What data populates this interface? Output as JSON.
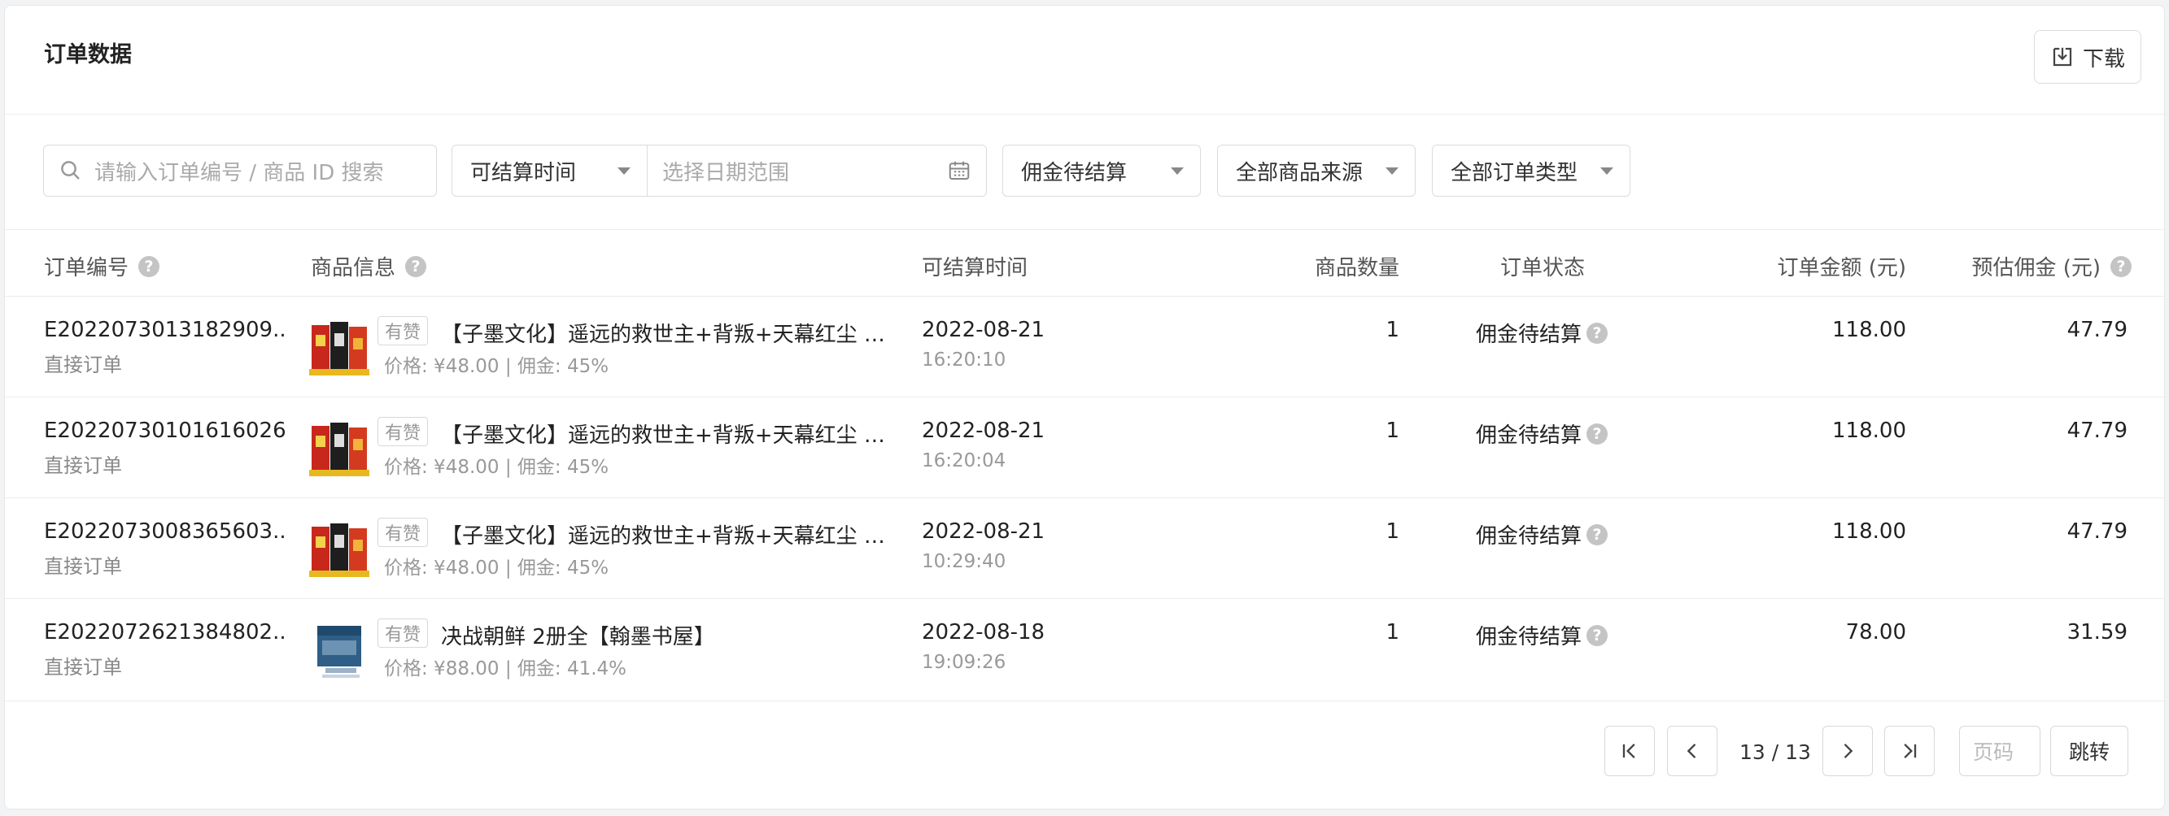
{
  "header": {
    "title": "订单数据",
    "download_label": "下载"
  },
  "filters": {
    "search_placeholder": "请输入订单编号 / 商品 ID 搜索",
    "time_select": "可结算时间",
    "date_placeholder": "选择日期范围",
    "commission_status": "佣金待结算",
    "product_source": "全部商品来源",
    "order_type": "全部订单类型"
  },
  "table": {
    "columns": [
      "订单编号",
      "商品信息",
      "可结算时间",
      "商品数量",
      "订单状态",
      "订单金额 (元)",
      "预估佣金 (元)"
    ],
    "rows": [
      {
        "order_id": "E2022073013182909...",
        "order_type": "直接订单",
        "tag": "有赞",
        "product_name": "【子墨文化】遥远的救世主+背叛+天幕红尘 豆...",
        "product_meta": "价格: ¥48.00 | 佣金: 45%",
        "settle_date": "2022-08-21",
        "settle_time": "16:20:10",
        "quantity": "1",
        "status": "佣金待结算",
        "amount": "118.00",
        "commission": "47.79",
        "thumb": "book-set"
      },
      {
        "order_id": "E20220730101616026...",
        "order_type": "直接订单",
        "tag": "有赞",
        "product_name": "【子墨文化】遥远的救世主+背叛+天幕红尘 豆...",
        "product_meta": "价格: ¥48.00 | 佣金: 45%",
        "settle_date": "2022-08-21",
        "settle_time": "16:20:04",
        "quantity": "1",
        "status": "佣金待结算",
        "amount": "118.00",
        "commission": "47.79",
        "thumb": "book-set"
      },
      {
        "order_id": "E2022073008365603...",
        "order_type": "直接订单",
        "tag": "有赞",
        "product_name": "【子墨文化】遥远的救世主+背叛+天幕红尘 豆...",
        "product_meta": "价格: ¥48.00 | 佣金: 45%",
        "settle_date": "2022-08-21",
        "settle_time": "10:29:40",
        "quantity": "1",
        "status": "佣金待结算",
        "amount": "118.00",
        "commission": "47.79",
        "thumb": "book-set"
      },
      {
        "order_id": "E2022072621384802...",
        "order_type": "直接订单",
        "tag": "有赞",
        "product_name": "决战朝鲜 2册全【翰墨书屋】",
        "product_meta": "价格: ¥88.00 | 佣金: 41.4%",
        "settle_date": "2022-08-18",
        "settle_time": "19:09:26",
        "quantity": "1",
        "status": "佣金待结算",
        "amount": "78.00",
        "commission": "31.59",
        "thumb": "book-blue"
      }
    ]
  },
  "pagination": {
    "info": "13 / 13",
    "page_placeholder": "页码",
    "jump_label": "跳转"
  },
  "colors": {
    "border": "#dcdcdc",
    "muted": "#999999",
    "help_icon": "#c4c4c4"
  }
}
